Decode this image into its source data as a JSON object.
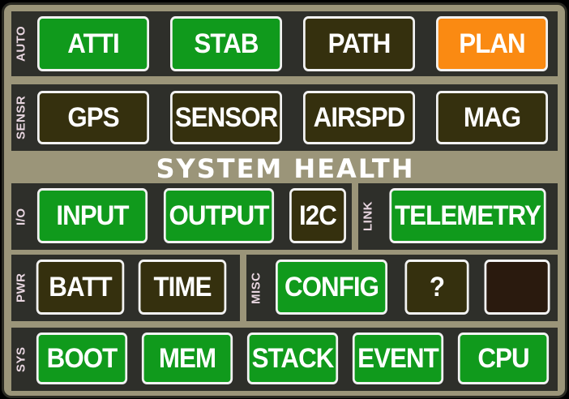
{
  "title": "SYSTEM HEALTH",
  "colors": {
    "ok": "#109a1c",
    "idle": "#35300e",
    "warn": "#fa8a12",
    "off": "#2a1a0e"
  },
  "groups": {
    "auto": {
      "label": "AUTO",
      "buttons": [
        {
          "label": "ATTI",
          "state": "ok"
        },
        {
          "label": "STAB",
          "state": "ok"
        },
        {
          "label": "PATH",
          "state": "idle"
        },
        {
          "label": "PLAN",
          "state": "warn"
        }
      ]
    },
    "sensr": {
      "label": "SENSR",
      "buttons": [
        {
          "label": "GPS",
          "state": "idle"
        },
        {
          "label": "SENSOR",
          "state": "idle"
        },
        {
          "label": "AIRSPD",
          "state": "idle"
        },
        {
          "label": "MAG",
          "state": "idle"
        }
      ]
    },
    "io": {
      "label": "I/O",
      "buttons": [
        {
          "label": "INPUT",
          "state": "ok"
        },
        {
          "label": "OUTPUT",
          "state": "ok"
        },
        {
          "label": "I2C",
          "state": "idle"
        }
      ]
    },
    "link": {
      "label": "LINK",
      "buttons": [
        {
          "label": "TELEMETRY",
          "state": "ok"
        }
      ]
    },
    "pwr": {
      "label": "PWR",
      "buttons": [
        {
          "label": "BATT",
          "state": "idle"
        },
        {
          "label": "TIME",
          "state": "idle"
        }
      ]
    },
    "misc": {
      "label": "MISC",
      "buttons": [
        {
          "label": "CONFIG",
          "state": "ok"
        },
        {
          "label": "?",
          "state": "idle"
        },
        {
          "label": "",
          "state": "off"
        }
      ]
    },
    "sys": {
      "label": "SYS",
      "buttons": [
        {
          "label": "BOOT",
          "state": "ok"
        },
        {
          "label": "MEM",
          "state": "ok"
        },
        {
          "label": "STACK",
          "state": "ok"
        },
        {
          "label": "EVENT",
          "state": "ok"
        },
        {
          "label": "CPU",
          "state": "ok"
        }
      ]
    }
  }
}
